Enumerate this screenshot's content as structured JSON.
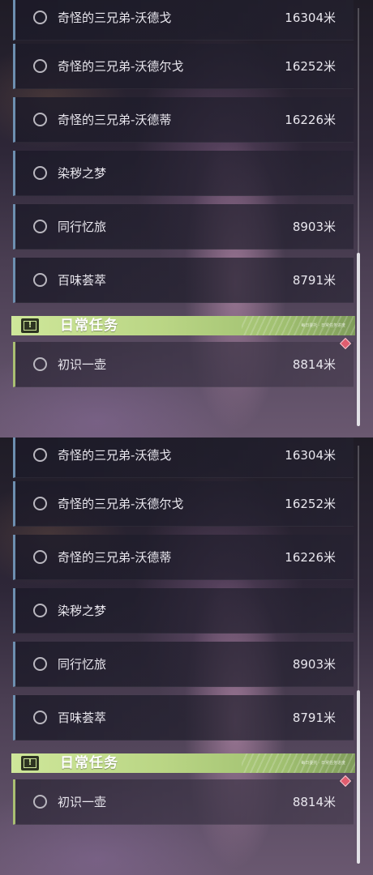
{
  "panels": [
    {
      "quests_top": [
        {
          "name": "奇怪的三兄弟-沃德戈",
          "distance": "16304米"
        },
        {
          "name": "奇怪的三兄弟-沃德尔戈",
          "distance": "16252米"
        },
        {
          "name": "奇怪的三兄弟-沃德蒂",
          "distance": "16226米"
        },
        {
          "name": "染秽之梦",
          "distance": ""
        },
        {
          "name": "同行忆旅",
          "distance": "8903米"
        },
        {
          "name": "百味荟萃",
          "distance": "8791米"
        }
      ],
      "category": {
        "title": "日常任务",
        "icon": "exclamation-icon",
        "tag_text": "每日委托 · 日常任务进度",
        "accent": "#b9d584"
      },
      "daily_quests": [
        {
          "name": "初识一壶",
          "distance": "8814米"
        }
      ]
    },
    {
      "quests_top": [
        {
          "name": "奇怪的三兄弟-沃德戈",
          "distance": "16304米"
        },
        {
          "name": "奇怪的三兄弟-沃德尔戈",
          "distance": "16252米"
        },
        {
          "name": "奇怪的三兄弟-沃德蒂",
          "distance": "16226米"
        },
        {
          "name": "染秽之梦",
          "distance": ""
        },
        {
          "name": "同行忆旅",
          "distance": "8903米"
        },
        {
          "name": "百味荟萃",
          "distance": "8791米"
        }
      ],
      "category": {
        "title": "日常任务",
        "icon": "exclamation-icon",
        "tag_text": "每日委托 · 日常任务进度",
        "accent": "#b9d584"
      },
      "daily_quests": [
        {
          "name": "初识一壶",
          "distance": "8814米"
        }
      ]
    }
  ],
  "colors": {
    "quest_accent": "#6d8fb0",
    "daily_accent": "#a9bf72",
    "tracked_marker": "#e05d6f"
  },
  "icons": {
    "status": "circle-outline-icon",
    "tracked": "diamond-marker-icon"
  }
}
